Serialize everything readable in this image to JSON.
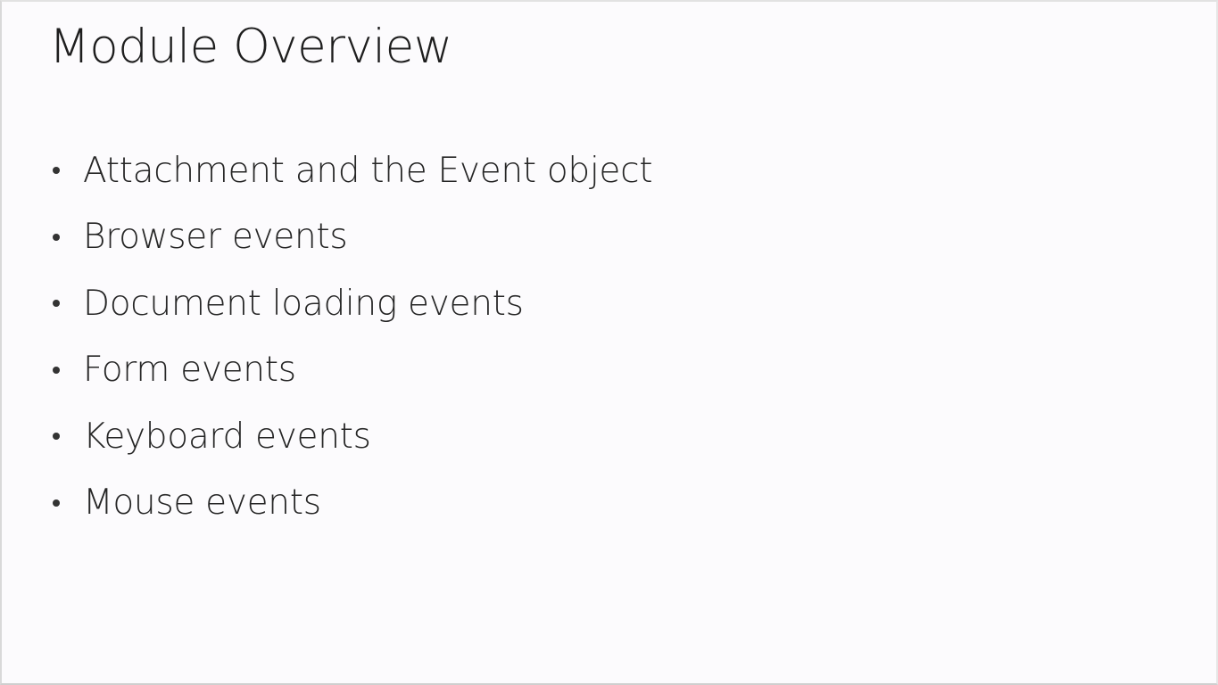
{
  "slide": {
    "title": "Module Overview",
    "bullets": [
      "Attachment and the Event object",
      "Browser events",
      "Document loading events",
      "Form events",
      "Keyboard events",
      "Mouse events"
    ]
  }
}
